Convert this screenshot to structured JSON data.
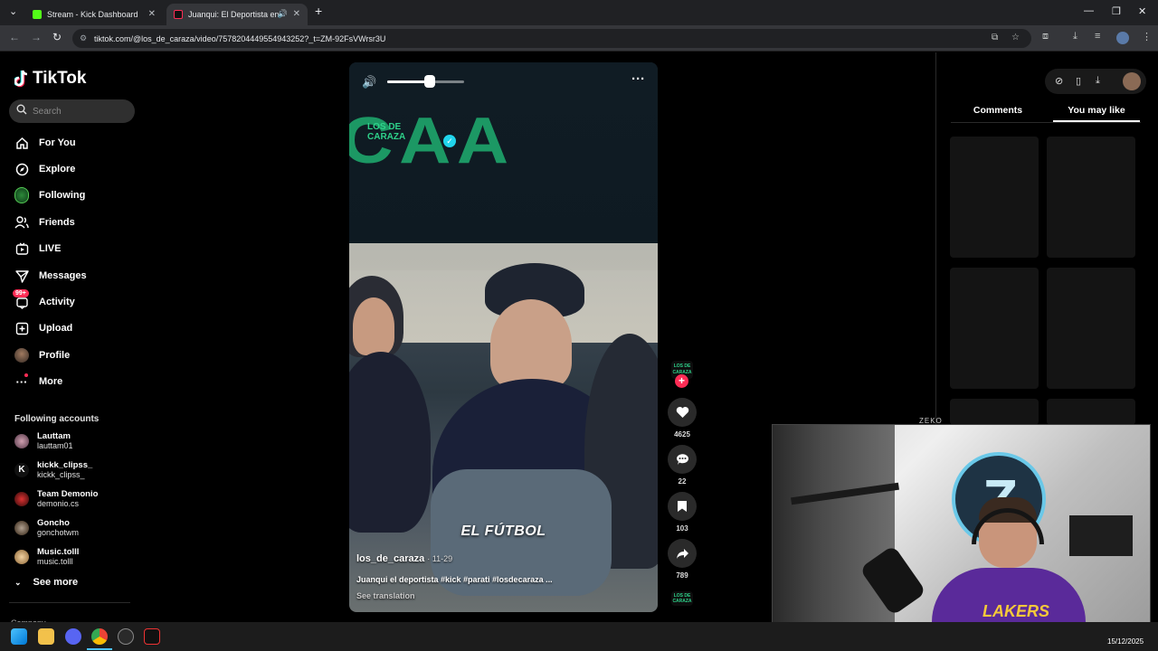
{
  "browser": {
    "tabs": [
      {
        "title": "Stream - Kick Dashboard",
        "active": false
      },
      {
        "title": "Juanqui: El Deportista en A",
        "active": true
      }
    ],
    "url": "tiktok.com/@los_de_caraza/video/7578204449554943252?_t=ZM-92FsVWrsr3U"
  },
  "sidebar": {
    "logo": "TikTok",
    "search_placeholder": "Search",
    "nav": [
      {
        "label": "For You",
        "icon": "home-icon"
      },
      {
        "label": "Explore",
        "icon": "compass-icon"
      },
      {
        "label": "Following",
        "icon": "following-avatar-icon"
      },
      {
        "label": "Friends",
        "icon": "friends-icon"
      },
      {
        "label": "LIVE",
        "icon": "live-icon"
      },
      {
        "label": "Messages",
        "icon": "messages-icon"
      },
      {
        "label": "Activity",
        "icon": "activity-icon",
        "badge": "99+"
      },
      {
        "label": "Upload",
        "icon": "upload-icon"
      },
      {
        "label": "Profile",
        "icon": "profile-avatar-icon"
      },
      {
        "label": "More",
        "icon": "more-icon"
      }
    ],
    "following_title": "Following accounts",
    "accounts": [
      {
        "display": "Lauttam",
        "user": "lauttam01",
        "color": "#7a5a6a"
      },
      {
        "display": "kickk_clipss_",
        "user": "kickk_clipss_",
        "color": "#111111"
      },
      {
        "display": "Team Demonio",
        "user": "demonio.cs",
        "color": "#8a1a1a"
      },
      {
        "display": "Goncho",
        "user": "gonchotwm",
        "color": "#6a5a4a"
      },
      {
        "display": "Music.tolll",
        "user": "music.tolll",
        "color": "#c9a06a"
      }
    ],
    "see_more": "See more",
    "section_cut": "Company"
  },
  "video": {
    "banner_text": "CAA",
    "banner_logo": "LOS DE\nCARAZA",
    "overlay_caption": "EL FÚTBOL",
    "author": "los_de_caraza",
    "date": "· 11-29",
    "description": "Juanqui el deportista #kick #parati #losdecaraza ...",
    "see_translation": "See translation",
    "volume_level": 0.55
  },
  "actions": {
    "avatar_label": "LOS DE CARAZA",
    "likes": "4625",
    "comments": "22",
    "saves": "103",
    "shares": "789"
  },
  "right_panel": {
    "tabs": [
      "Comments",
      "You may like"
    ],
    "active_tab": "You may like"
  },
  "webcam": {
    "title": "ZEKO",
    "shirt_text": "LAKERS"
  },
  "taskbar": {
    "date": "15/12/2025"
  }
}
